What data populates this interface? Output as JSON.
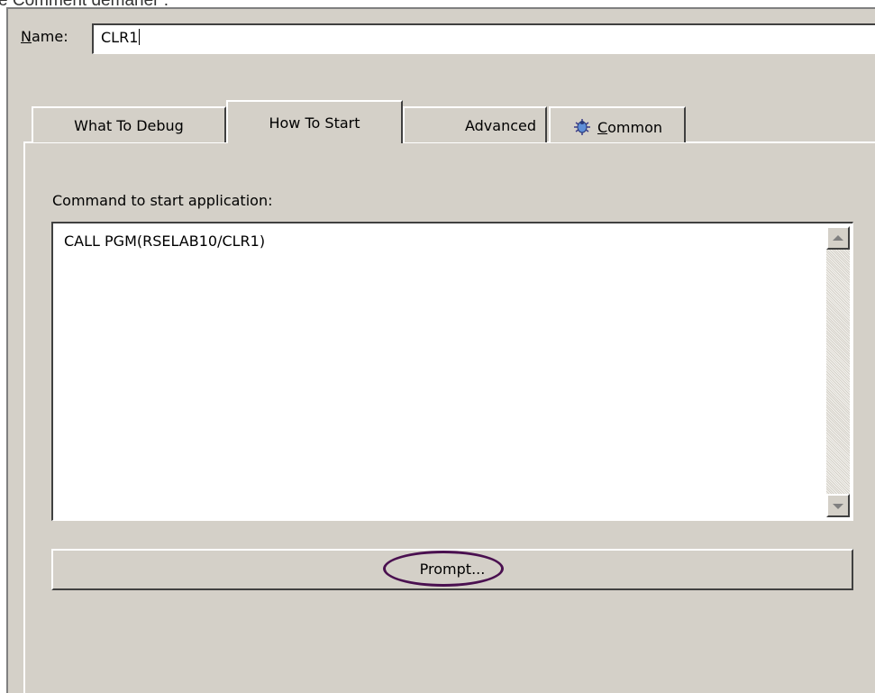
{
  "top_caption": "e Comment demaner :",
  "name_field": {
    "label_mnemonic": "N",
    "label_rest": "ame:",
    "value": "CLR1"
  },
  "tabs": [
    {
      "label": "What To Debug",
      "selected": false
    },
    {
      "label": "How To Start",
      "selected": true
    },
    {
      "label": "Advanced",
      "selected": false
    },
    {
      "label_mnemonic": "C",
      "label_rest": "ommon",
      "icon": "bug-icon",
      "selected": false
    }
  ],
  "command": {
    "label": "Command to start application:",
    "value": "CALL PGM(RSELAB10/CLR1)"
  },
  "prompt_button": {
    "label": "Prompt..."
  },
  "colors": {
    "dialog_bg": "#d4d0c8",
    "highlight_ellipse": "#4a1050"
  }
}
